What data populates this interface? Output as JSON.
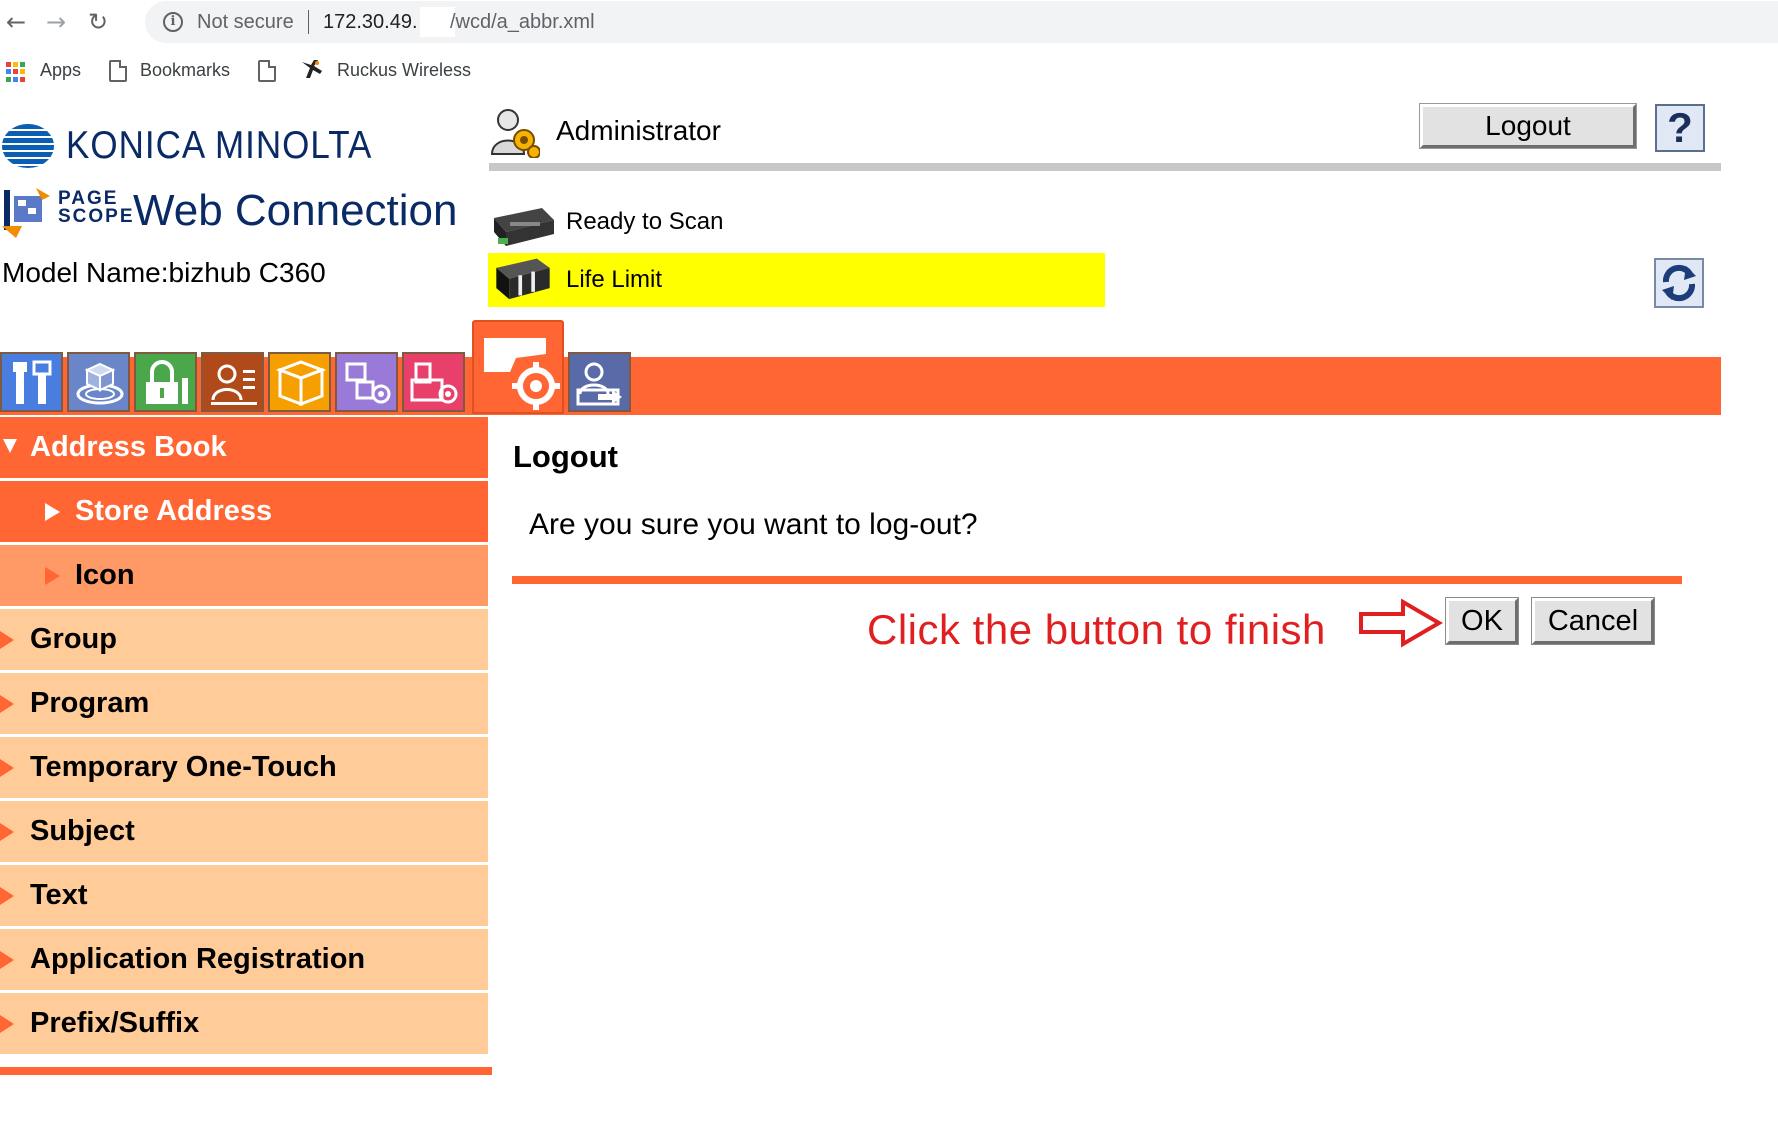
{
  "browser": {
    "not_secure": "Not secure",
    "url_host": "172.30.49.",
    "url_path": "/wcd/a_abbr.xml",
    "bookmarks": {
      "apps": "Apps",
      "bookmarks": "Bookmarks",
      "ruckus": "Ruckus Wireless"
    }
  },
  "header": {
    "brand": "KONICA MINOLTA",
    "pagescope_line1": "PAGE",
    "pagescope_line2": "SCOPE",
    "product": "Web Connection",
    "model": "Model Name:bizhub C360",
    "user": "Administrator",
    "logout_label": "Logout",
    "help_label": "?"
  },
  "status": {
    "line1": "Ready to Scan",
    "line2": "Life Limit",
    "highlight_color": "#ffff00"
  },
  "sidebar": {
    "section": "Address Book",
    "selected": "Store Address",
    "sub": "Icon",
    "items": [
      "Group",
      "Program",
      "Temporary One-Touch",
      "Subject",
      "Text",
      "Application Registration",
      "Prefix/Suffix"
    ]
  },
  "main": {
    "title": "Logout",
    "question": "Are you sure you want to log-out?",
    "hint": "Click the button to finish",
    "ok_label": "OK",
    "cancel_label": "Cancel"
  },
  "colors": {
    "accent": "#ff6633",
    "sidebar_item": "#ffcc99",
    "sidebar_sub": "#ff9966",
    "hint": "#e02020",
    "brand": "#0a2a66"
  }
}
